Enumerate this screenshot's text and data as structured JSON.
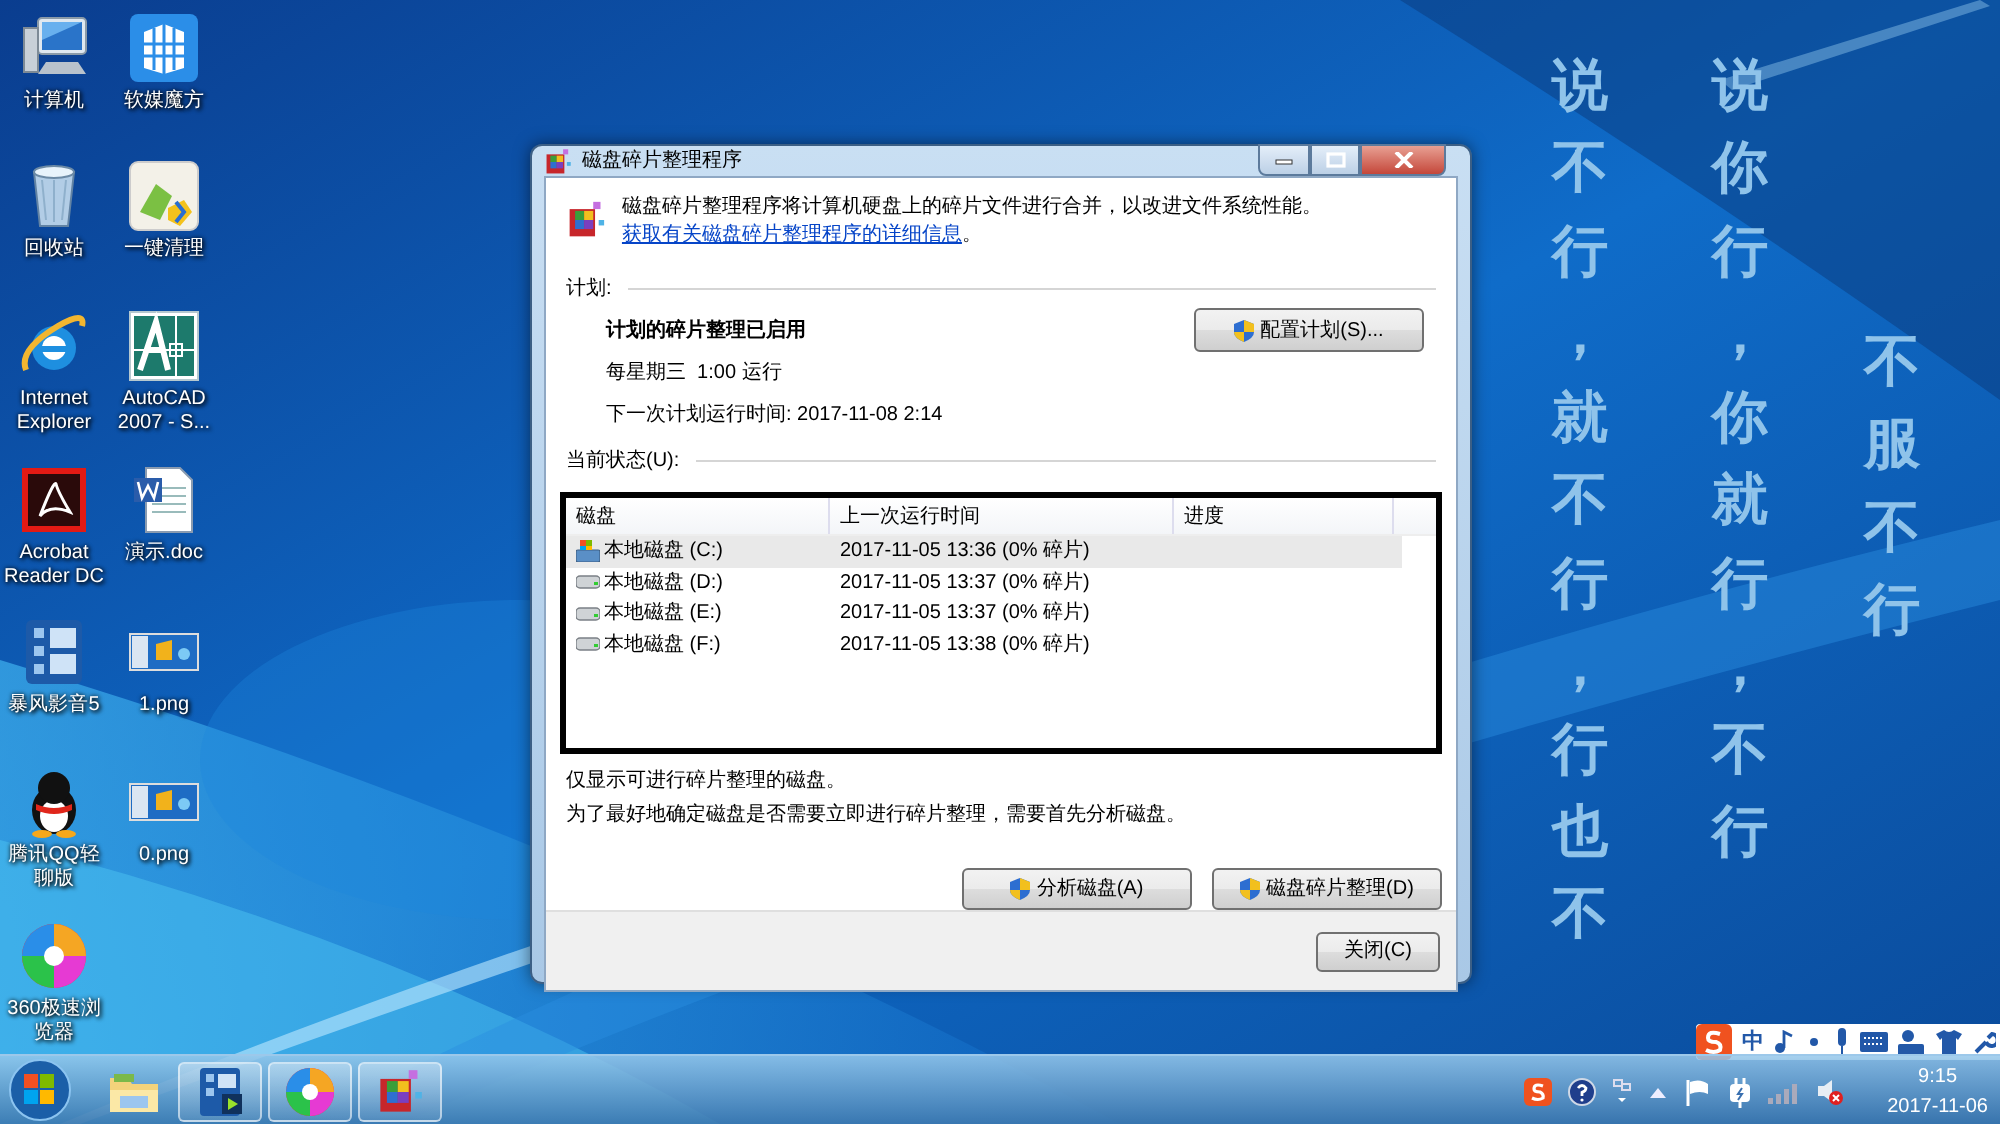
{
  "desktop": {
    "icons": [
      {
        "label": "计算机"
      },
      {
        "label": "回收站"
      },
      {
        "label": "Internet Explorer"
      },
      {
        "label": "Acrobat Reader DC"
      },
      {
        "label": "暴风影音5"
      },
      {
        "label": "腾讯QQ轻聊版"
      },
      {
        "label": "360极速浏览器"
      },
      {
        "label": "软媒魔方"
      },
      {
        "label": "一键清理"
      },
      {
        "label": "AutoCAD 2007 - S..."
      },
      {
        "label": "演示.doc"
      },
      {
        "label": "1.png"
      },
      {
        "label": "0.png"
      }
    ]
  },
  "wallpaper_text": [
    "说不行，就不行，行也不",
    "说你行，你就行，不行",
    "不服不行"
  ],
  "dialog": {
    "title": "磁盘碎片整理程序",
    "intro": "磁盘碎片整理程序将计算机硬盘上的碎片文件进行合并，以改进文件系统性能。",
    "intro_link": "获取有关磁盘碎片整理程序的详细信息",
    "intro_end": "。",
    "schedule": {
      "label": "计划:",
      "status": "计划的碎片整理已启用",
      "frequency": "每星期三  1:00 运行",
      "next_run": "下一次计划运行时间: 2017-11-08 2:14",
      "configure_button": "配置计划(S)..."
    },
    "current_status": {
      "label": "当前状态(U):",
      "columns": [
        "磁盘",
        "上一次运行时间",
        "进度"
      ],
      "rows": [
        {
          "kind": "system",
          "disk": "本地磁盘 (C:)",
          "last_run": "2017-11-05 13:36 (0% 碎片)",
          "selected": true
        },
        {
          "kind": "data",
          "disk": "本地磁盘 (D:)",
          "last_run": "2017-11-05 13:37 (0% 碎片)",
          "selected": false
        },
        {
          "kind": "data",
          "disk": "本地磁盘 (E:)",
          "last_run": "2017-11-05 13:37 (0% 碎片)",
          "selected": false
        },
        {
          "kind": "data",
          "disk": "本地磁盘 (F:)",
          "last_run": "2017-11-05 13:38 (0% 碎片)",
          "selected": false
        }
      ]
    },
    "notes": [
      "仅显示可进行碎片整理的磁盘。",
      "为了最好地确定磁盘是否需要立即进行碎片整理，需要首先分析磁盘。"
    ],
    "buttons": [
      "分析磁盘(A)",
      "磁盘碎片整理(D)"
    ],
    "close_button": "关闭(C)"
  },
  "ime_toolbar": {
    "mode": "中"
  },
  "taskbar": {
    "apps": [
      {
        "running": false
      },
      {
        "running": true
      },
      {
        "running": true
      },
      {
        "running": true
      }
    ],
    "tray": {
      "muted": true
    },
    "clock": {
      "time": "9:15",
      "date": "2017-11-06"
    }
  }
}
